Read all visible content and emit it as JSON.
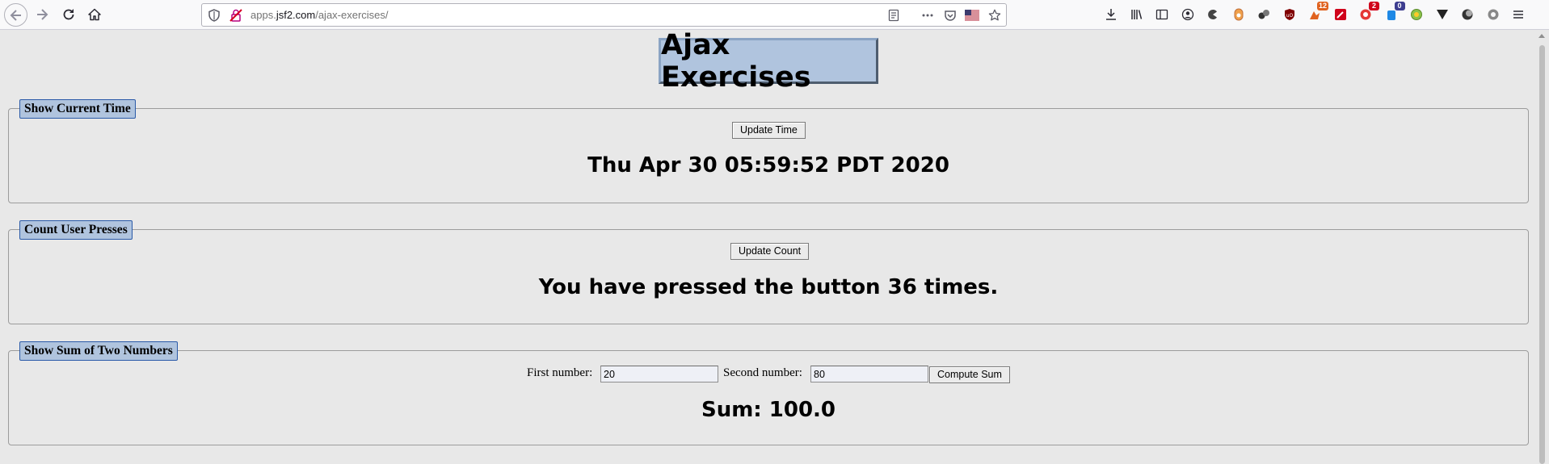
{
  "browser": {
    "url_prefix": "apps.",
    "url_host": "jsf2.com",
    "url_path": "/ajax-exercises/",
    "badges": {
      "ext1": "12",
      "ext2": "2",
      "ext3": "0"
    }
  },
  "page": {
    "title": "Ajax Exercises",
    "time_section": {
      "legend": "Show Current Time",
      "button_label": "Update Time",
      "result": "Thu Apr 30 05:59:52 PDT 2020"
    },
    "count_section": {
      "legend": "Count User Presses",
      "button_label": "Update Count",
      "result": "You have pressed the button 36 times."
    },
    "sum_section": {
      "legend": "Show Sum of Two Numbers",
      "first_label": "First number:",
      "first_value": "20",
      "second_label": "Second number:",
      "second_value": "80",
      "button_label": "Compute Sum",
      "result": "Sum: 100.0"
    }
  }
}
